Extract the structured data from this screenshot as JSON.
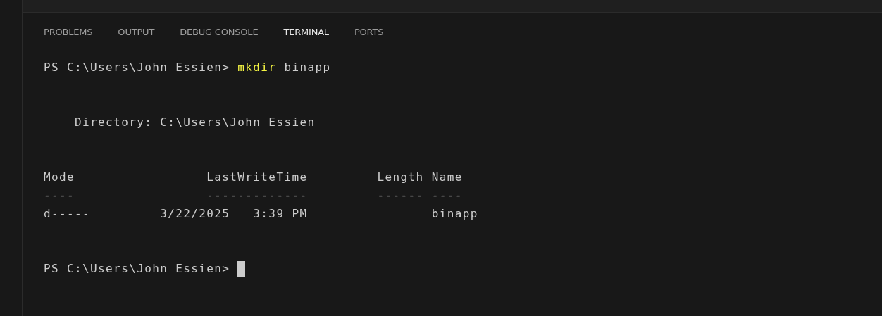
{
  "tabs": [
    {
      "label": "PROBLEMS",
      "selected": false
    },
    {
      "label": "OUTPUT",
      "selected": false
    },
    {
      "label": "DEBUG CONSOLE",
      "selected": false
    },
    {
      "label": "TERMINAL",
      "selected": true
    },
    {
      "label": "PORTS",
      "selected": false
    }
  ],
  "terminal": {
    "lines": [
      {
        "kind": "command",
        "prompt": "PS C:\\Users\\John Essien>",
        "command": "mkdir",
        "args": "binapp"
      },
      {
        "kind": "blank"
      },
      {
        "kind": "blank"
      },
      {
        "kind": "output",
        "text": "    Directory: C:\\Users\\John Essien"
      },
      {
        "kind": "blank"
      },
      {
        "kind": "blank"
      },
      {
        "kind": "output",
        "text": "Mode                 LastWriteTime         Length Name"
      },
      {
        "kind": "output",
        "text": "----                 -------------         ------ ----"
      },
      {
        "kind": "output",
        "text": "d-----         3/22/2025   3:39 PM                binapp"
      },
      {
        "kind": "blank"
      },
      {
        "kind": "blank"
      },
      {
        "kind": "prompt",
        "prompt": "PS C:\\Users\\John Essien>",
        "cursor": true
      }
    ]
  }
}
